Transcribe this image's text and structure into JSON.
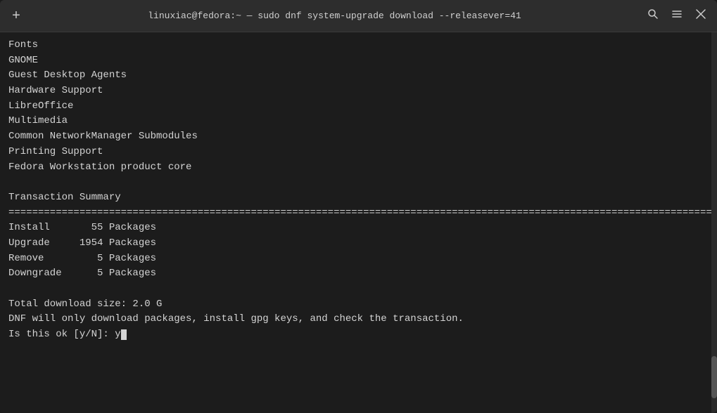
{
  "titlebar": {
    "new_tab_label": "+",
    "title": "linuxiac@fedora:~ — sudo dnf system-upgrade download --releasever=41",
    "search_icon": "🔍",
    "menu_icon": "≡",
    "close_icon": "✕"
  },
  "terminal": {
    "lines": [
      "Fonts",
      "GNOME",
      "Guest Desktop Agents",
      "Hardware Support",
      "LibreOffice",
      "Multimedia",
      "Common NetworkManager Submodules",
      "Printing Support",
      "Fedora Workstation product core",
      "",
      "Transaction Summary",
      "================================================================================================================================================",
      "Install       55 Packages",
      "Upgrade     1954 Packages",
      "Remove         5 Packages",
      "Downgrade      5 Packages",
      "",
      "Total download size: 2.0 G",
      "DNF will only download packages, install gpg keys, and check the transaction.",
      "Is this ok [y/N]: y"
    ]
  }
}
